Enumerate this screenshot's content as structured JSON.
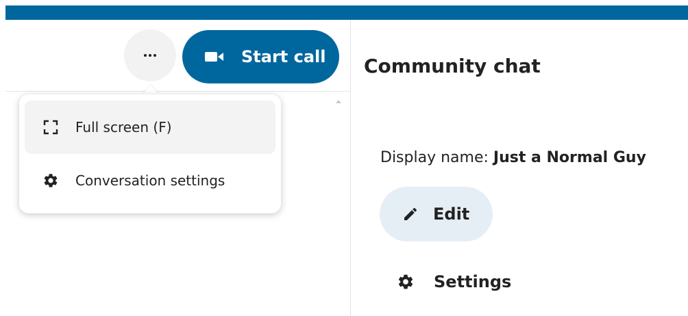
{
  "header": {
    "more_icon": "more-horizontal-icon",
    "start_call": {
      "label": "Start call",
      "icon": "video-camera-icon",
      "color": "#00679e"
    },
    "accent_color": "#00679e"
  },
  "menu": {
    "items": [
      {
        "label": "Full screen (F)",
        "icon": "fullscreen-icon"
      },
      {
        "label": "Conversation settings",
        "icon": "gear-icon"
      }
    ]
  },
  "sidebar": {
    "title": "Community chat",
    "display_name_label": "Display name:",
    "display_name_value": "Just a Normal Guy",
    "edit_label": "Edit",
    "edit_icon": "pencil-icon",
    "settings_label": "Settings",
    "settings_icon": "gear-icon"
  }
}
